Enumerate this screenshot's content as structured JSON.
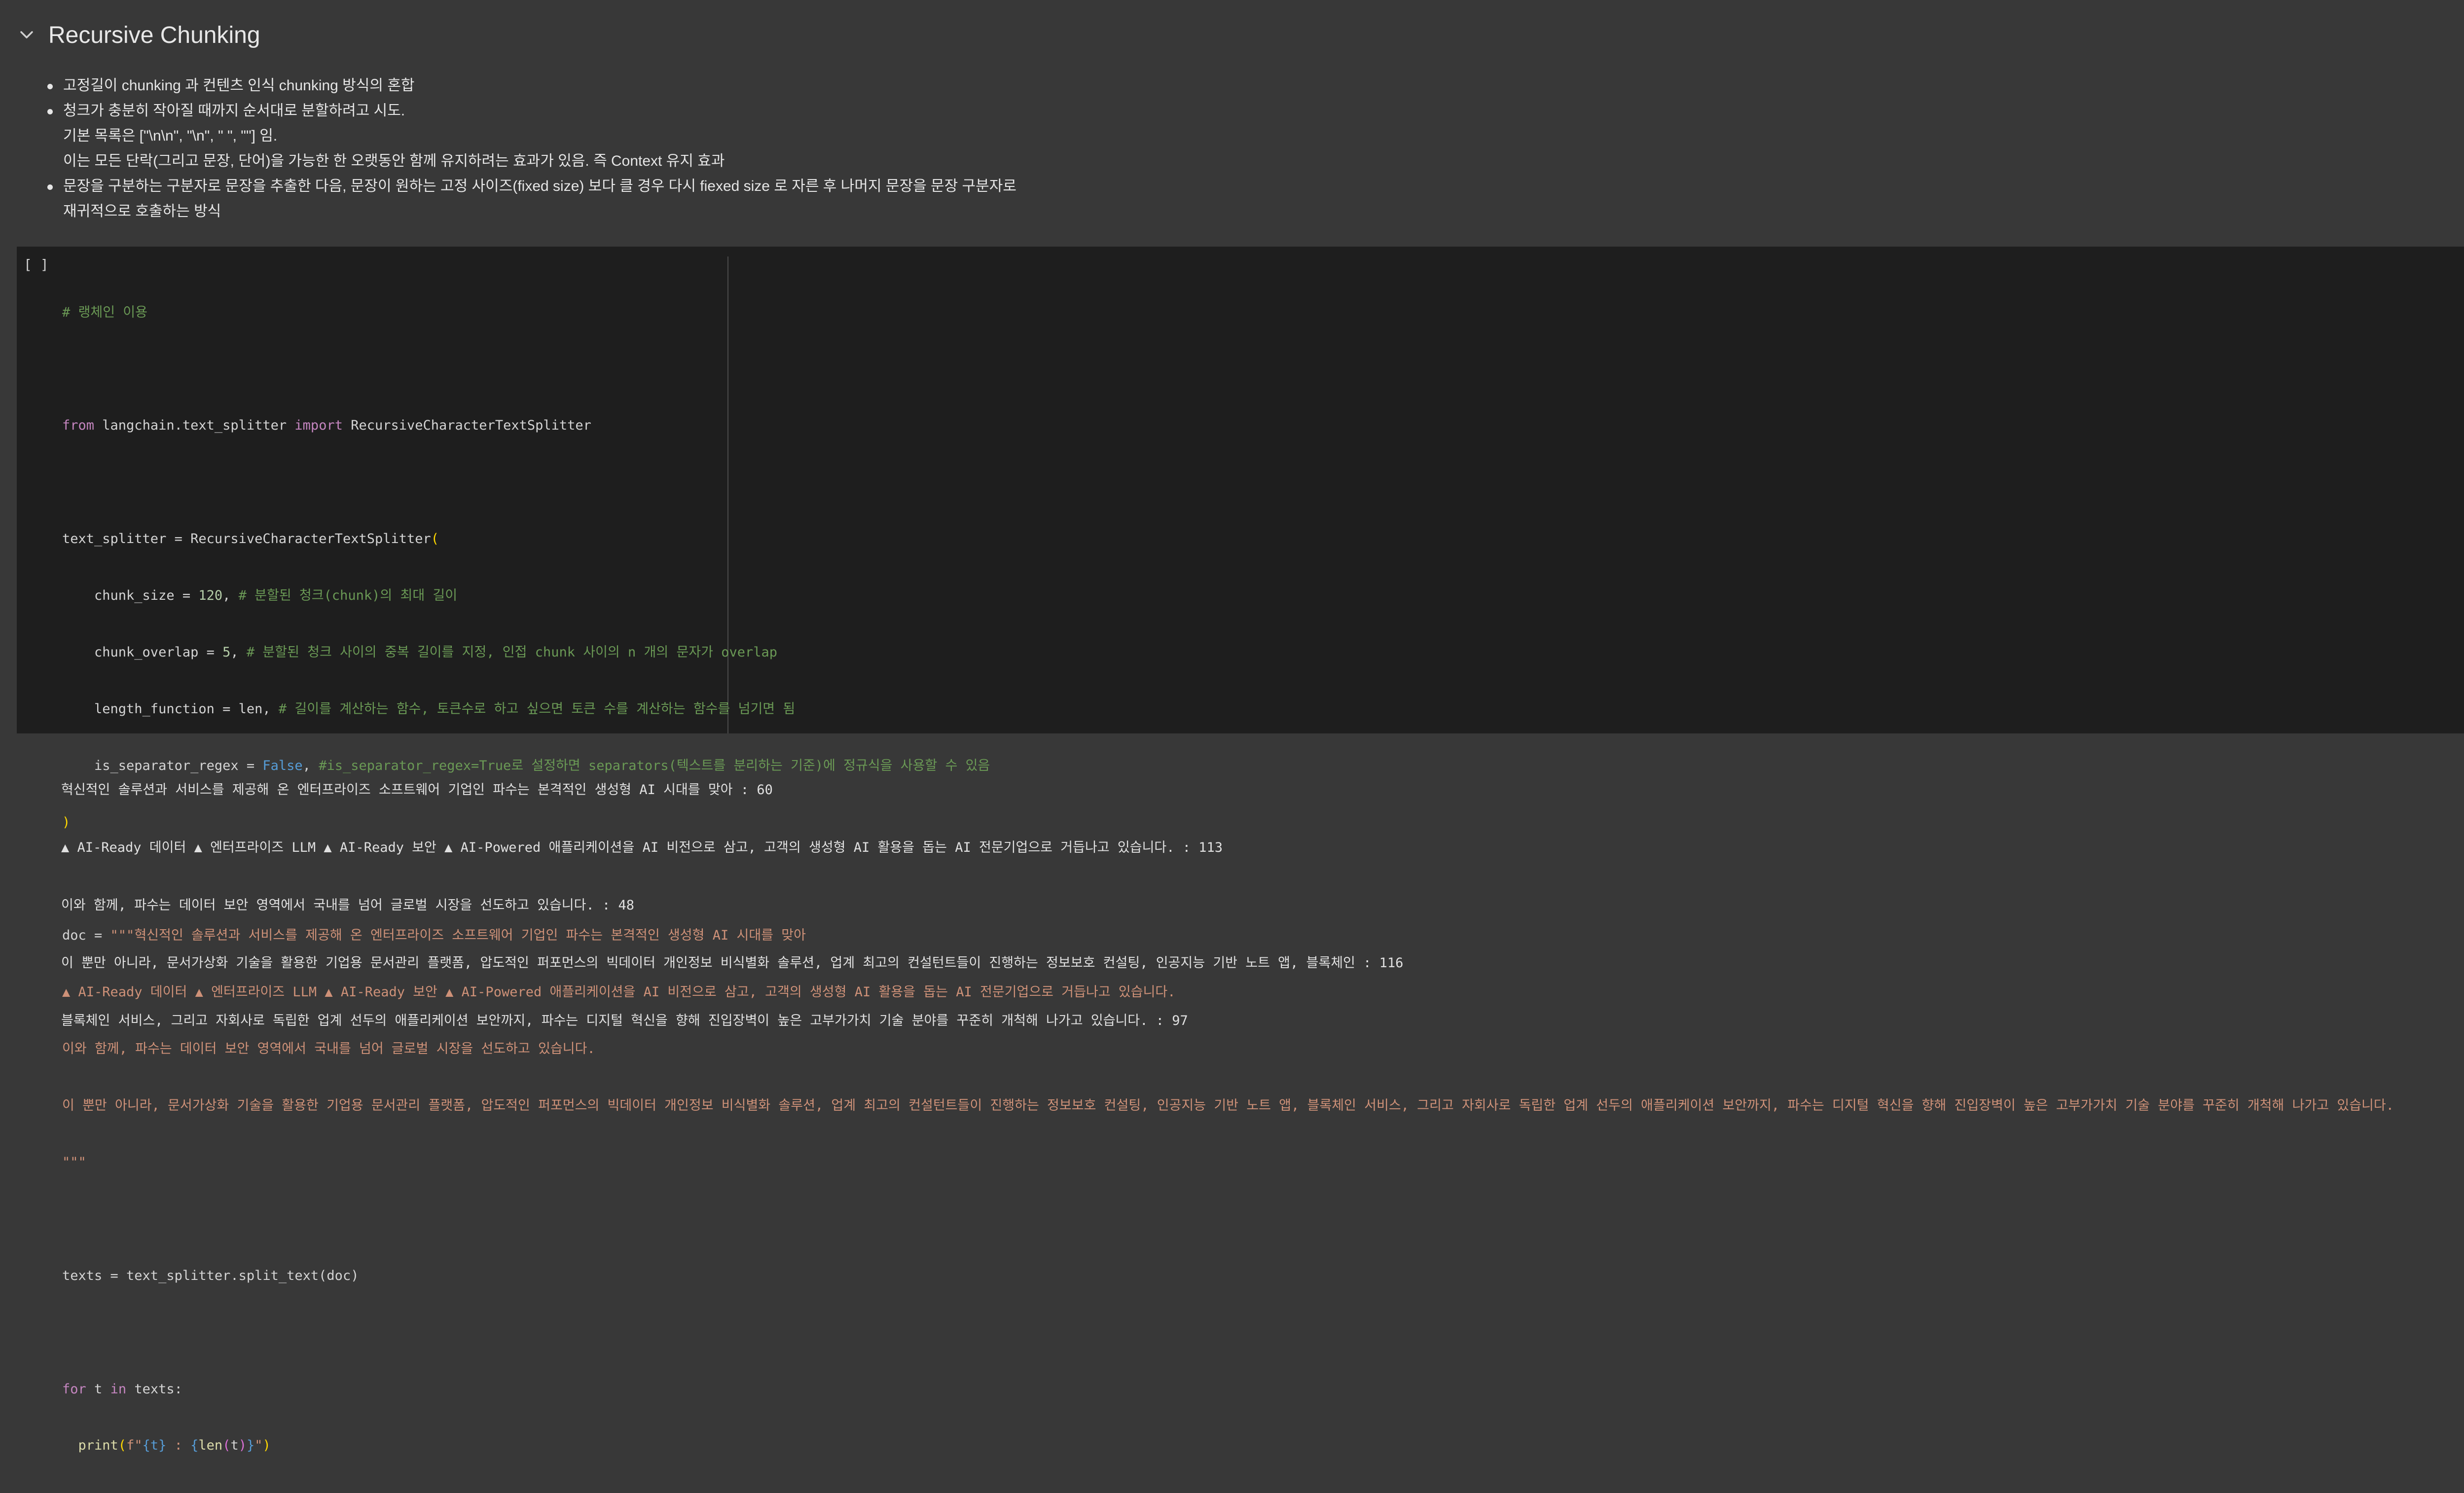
{
  "section": {
    "title": "Recursive Chunking",
    "bullets": [
      {
        "lines": [
          "고정길이 chunking 과 컨텐츠 인식 chunking 방식의 혼합"
        ]
      },
      {
        "lines": [
          "청크가 충분히 작아질 때까지 순서대로 분할하려고 시도.",
          "기본 목록은 [\"\\n\\n\", \"\\n\", \" \", \"\"] 임.",
          "이는 모든 단락(그리고 문장, 단어)을 가능한 한 오랫동안 함께 유지하려는 효과가 있음. 즉 Context 유지 효과"
        ]
      },
      {
        "lines": [
          "문장을 구분하는 구분자로 문장을 추출한 다음, 문장이 원하는 고정 사이즈(fixed size) 보다 클 경우 다시 fiexed size 로 자른 후 나머지 문장을 문장 구분자로",
          "재귀적으로 호출하는 방식"
        ]
      }
    ]
  },
  "cell": {
    "run_label": "[ ]",
    "code": {
      "l1": "# 랭체인 이용",
      "l2_kw1": "from",
      "l2_mod": " langchain.text_splitter ",
      "l2_kw2": "import",
      "l2_cls": " RecursiveCharacterTextSplitter",
      "l3_a": "text_splitter = RecursiveCharacterTextSplitter",
      "l4_a": "    chunk_size = ",
      "l4_n": "120",
      "l4_c": "# 분할된 청크(chunk)의 최대 길이",
      "l5_a": "    chunk_overlap = ",
      "l5_n": "5",
      "l5_c": "# 분할된 청크 사이의 중복 길이를 지정, 인접 chunk 사이의 n 개의 문자가 overlap",
      "l6_a": "    length_function = ",
      "l6_f": "len",
      "l6_c": "# 길이를 계산하는 함수, 토큰수로 하고 싶으면 토큰 수를 계산하는 함수를 넘기면 됨",
      "l7_a": "    is_separator_regex = ",
      "l7_v": "False",
      "l7_c": "#is_separator_regex=True로 설정하면 separators(텍스트를 분리하는 기준)에 정규식을 사용할 수 있음",
      "l9_a": "doc = ",
      "l9_s": "\"\"\"혁신적인 솔루션과 서비스를 제공해 온 엔터프라이즈 소프트웨어 기업인 파수는 본격적인 생성형 AI 시대를 맞아",
      "l10": "▲ AI-Ready 데이터 ▲ 엔터프라이즈 LLM ▲ AI-Ready 보안 ▲ AI-Powered 애플리케이션을 AI 비전으로 삼고, 고객의 생성형 AI 활용을 돕는 AI 전문기업으로 거듭나고 있습니다.",
      "l11": "이와 함께, 파수는 데이터 보안 영역에서 국내를 넘어 글로벌 시장을 선도하고 있습니다.",
      "l12": "이 뿐만 아니라, 문서가상화 기술을 활용한 기업용 문서관리 플랫폼, 압도적인 퍼포먼스의 빅데이터 개인정보 비식별화 솔루션, 업계 최고의 컨설턴트들이 진행하는 정보보호 컨설팅, 인공지능 기반 노트 앱, 블록체인 서비스, 그리고 자회사로 독립한 업계 선두의 애플리케이션 보안까지, 파수는 디지털 혁신을 향해 진입장벽이 높은 고부가가치 기술 분야를 꾸준히 개척해 나가고 있습니다.",
      "l13": "\"\"\"",
      "l15_a": "texts = text_splitter.split_text(doc)",
      "l17_kw": "for",
      "l17_a": " t ",
      "l17_kw2": "in",
      "l17_b": " texts:",
      "l18_a": "  print",
      "l18_s1": "f\"",
      "l18_t": "{t}",
      "l18_s2": " : ",
      "l18_len": "len",
      "l18_t2": "t",
      "l18_s3": "\""
    }
  },
  "output": {
    "lines": [
      "혁신적인 솔루션과 서비스를 제공해 온 엔터프라이즈 소프트웨어 기업인 파수는 본격적인 생성형 AI 시대를 맞아 : 60",
      "▲ AI-Ready 데이터 ▲ 엔터프라이즈 LLM ▲ AI-Ready 보안 ▲ AI-Powered 애플리케이션을 AI 비전으로 삼고, 고객의 생성형 AI 활용을 돕는 AI 전문기업으로 거듭나고 있습니다. : 113",
      "이와 함께, 파수는 데이터 보안 영역에서 국내를 넘어 글로벌 시장을 선도하고 있습니다. : 48",
      "이 뿐만 아니라, 문서가상화 기술을 활용한 기업용 문서관리 플랫폼, 압도적인 퍼포먼스의 빅데이터 개인정보 비식별화 솔루션, 업계 최고의 컨설턴트들이 진행하는 정보보호 컨설팅, 인공지능 기반 노트 앱, 블록체인 : 116",
      "블록체인 서비스, 그리고 자회사로 독립한 업계 선두의 애플리케이션 보안까지, 파수는 디지털 혁신을 향해 진입장벽이 높은 고부가가치 기술 분야를 꾸준히 개척해 나가고 있습니다. : 97"
    ]
  }
}
